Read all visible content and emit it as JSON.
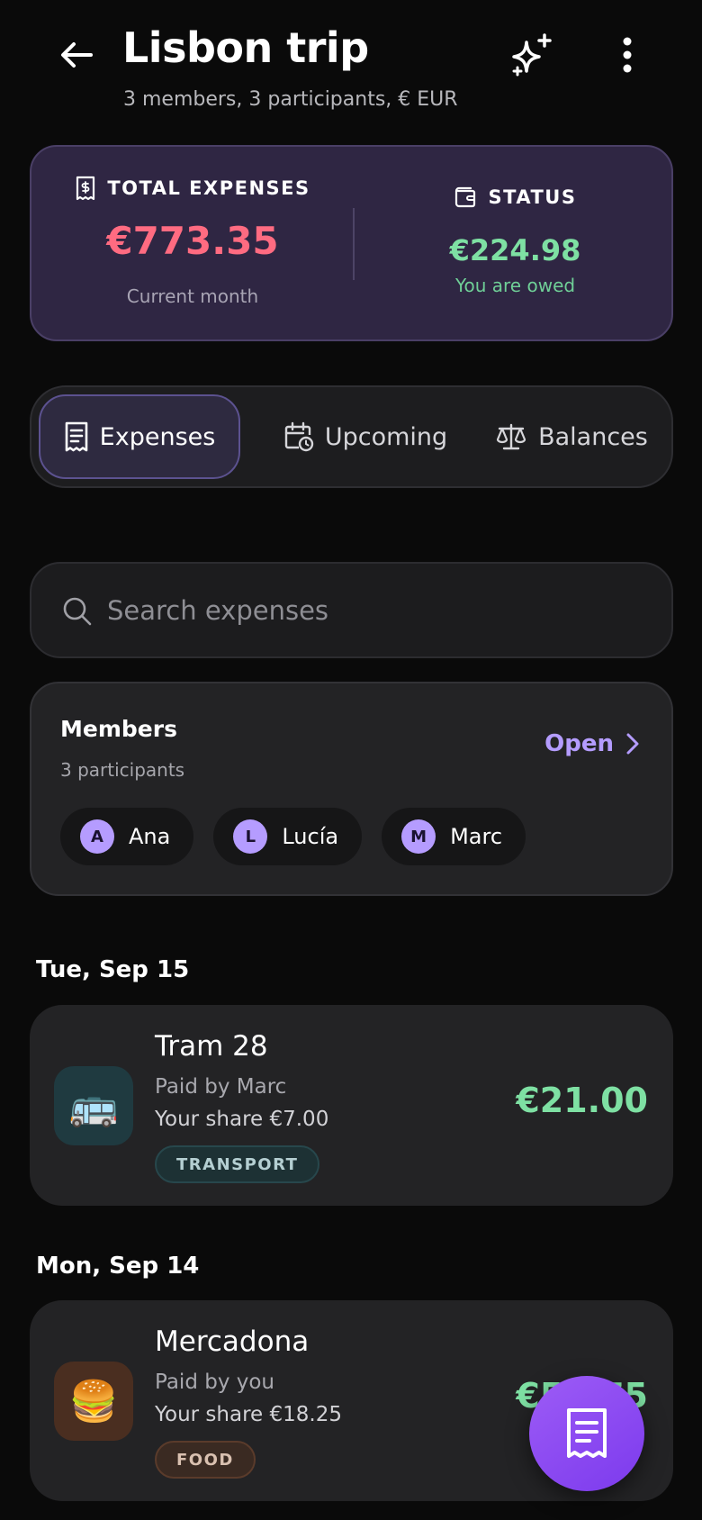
{
  "header": {
    "title": "Lisbon trip",
    "subtitle": "3 members, 3 participants, € EUR",
    "back_icon": "arrow-left-icon",
    "ai_icon": "sparkles-icon",
    "menu_icon": "more-vertical-icon"
  },
  "summary": {
    "total_label": "TOTAL EXPENSES",
    "total_value": "€773.35",
    "total_period": "Current month",
    "status_label": "STATUS",
    "status_value": "€224.98",
    "status_note": "You are owed",
    "colors": {
      "total": "#ff6b81",
      "owed": "#7ee0a3",
      "card_bg": "#2f2643"
    }
  },
  "tabs": [
    {
      "label": "Expenses",
      "icon": "receipt-icon",
      "active": true
    },
    {
      "label": "Upcoming",
      "icon": "calendar-clock-icon",
      "active": false
    },
    {
      "label": "Balances",
      "icon": "scale-icon",
      "active": false
    }
  ],
  "search": {
    "placeholder": "Search expenses",
    "value": ""
  },
  "members": {
    "title": "Members",
    "subtitle": "3 participants",
    "open_label": "Open",
    "people": [
      {
        "initial": "A",
        "name": "Ana"
      },
      {
        "initial": "L",
        "name": "Lucía"
      },
      {
        "initial": "M",
        "name": "Marc"
      }
    ]
  },
  "groups": [
    {
      "date": "Tue, Sep 15",
      "expense": {
        "title": "Tram 28",
        "paid_by": "Paid by Marc",
        "share": "Your share €7.00",
        "tag": "TRANSPORT",
        "amount": "€21.00",
        "emoji": "🚌",
        "icon": "bus-icon"
      }
    },
    {
      "date": "Mon, Sep 14",
      "expense": {
        "title": "Mercadona",
        "paid_by": "Paid by you",
        "share": "Your share €18.25",
        "tag": "FOOD",
        "amount": "€54.75",
        "emoji": "🍔",
        "icon": "burger-icon"
      }
    }
  ],
  "fab": {
    "icon": "receipt-add-icon"
  }
}
